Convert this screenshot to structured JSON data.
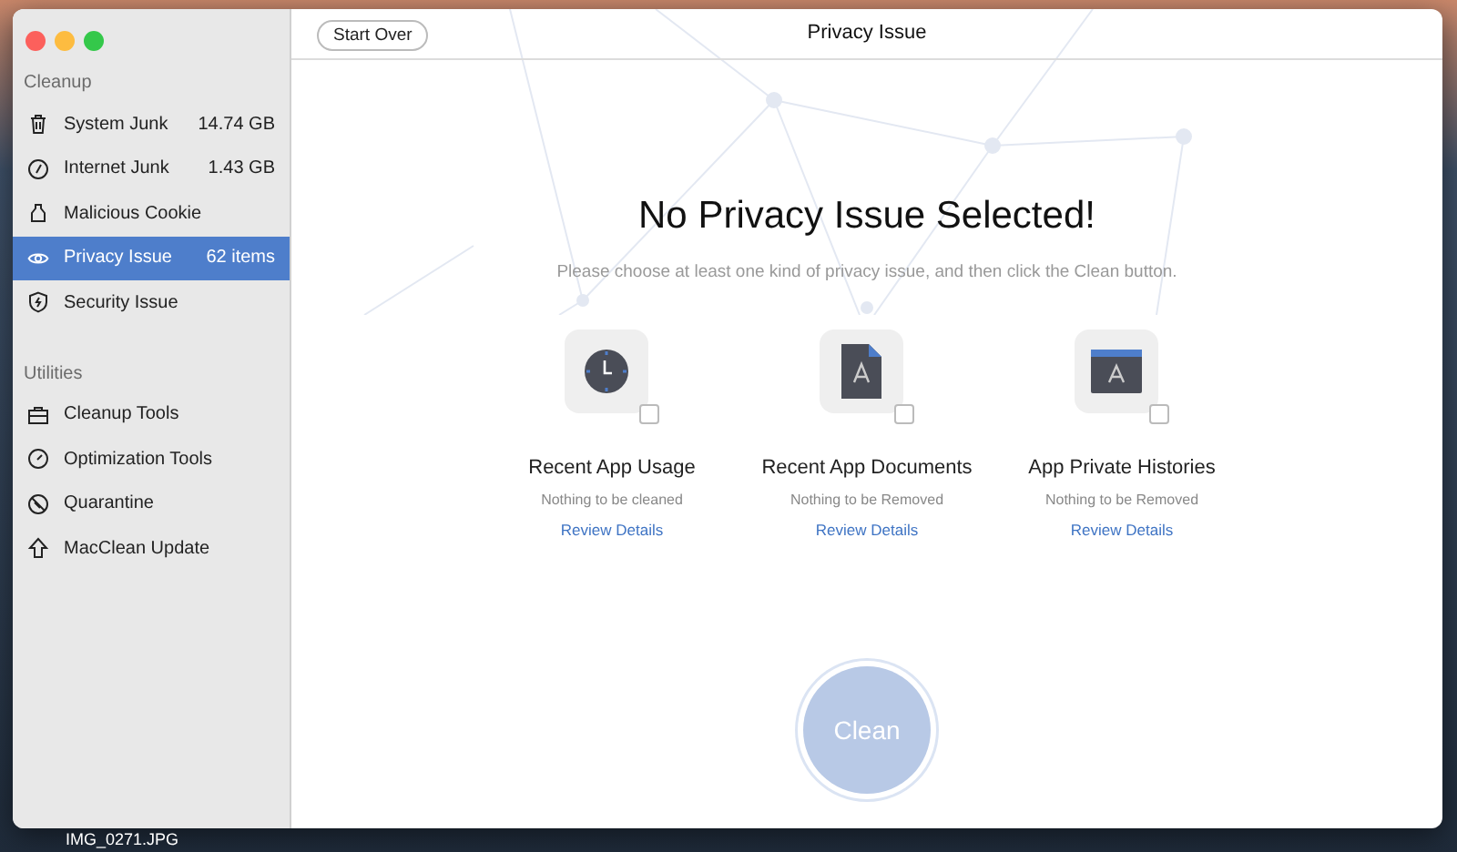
{
  "desktop": {
    "file_label": "IMG_0271.JPG"
  },
  "window": {
    "title": "Privacy Issue",
    "start_over": "Start Over"
  },
  "sidebar": {
    "sections": [
      {
        "heading": "Cleanup",
        "items": [
          {
            "label": "System Junk",
            "value": "14.74 GB",
            "selected": false
          },
          {
            "label": "Internet Junk",
            "value": "1.43 GB",
            "selected": false
          },
          {
            "label": "Malicious Cookie",
            "selected": false
          },
          {
            "label": "Privacy Issue",
            "value": "62 items",
            "selected": true
          },
          {
            "label": "Security Issue",
            "selected": false
          }
        ]
      },
      {
        "heading": "Utilities",
        "items": [
          {
            "label": "Cleanup Tools",
            "selected": false
          },
          {
            "label": "Optimization Tools",
            "selected": false
          },
          {
            "label": "Quarantine",
            "selected": false
          },
          {
            "label": "MacClean Update",
            "selected": false
          }
        ]
      }
    ]
  },
  "main": {
    "heading": "No Privacy Issue Selected!",
    "subtitle": "Please choose at least one kind of privacy issue, and then click the Clean button.",
    "categories": [
      {
        "kind": "clock",
        "title": "Recent App Usage",
        "status": "Nothing to be cleaned",
        "link": "Review Details",
        "checked": false
      },
      {
        "kind": "document",
        "title": "Recent App Documents",
        "status": "Nothing to be Removed",
        "link": "Review Details",
        "checked": false
      },
      {
        "kind": "folder",
        "title": "App Private Histories",
        "status": "Nothing to be Removed",
        "link": "Review Details",
        "checked": false
      }
    ],
    "clean_button": {
      "label": "Clean",
      "disabled": true
    }
  }
}
